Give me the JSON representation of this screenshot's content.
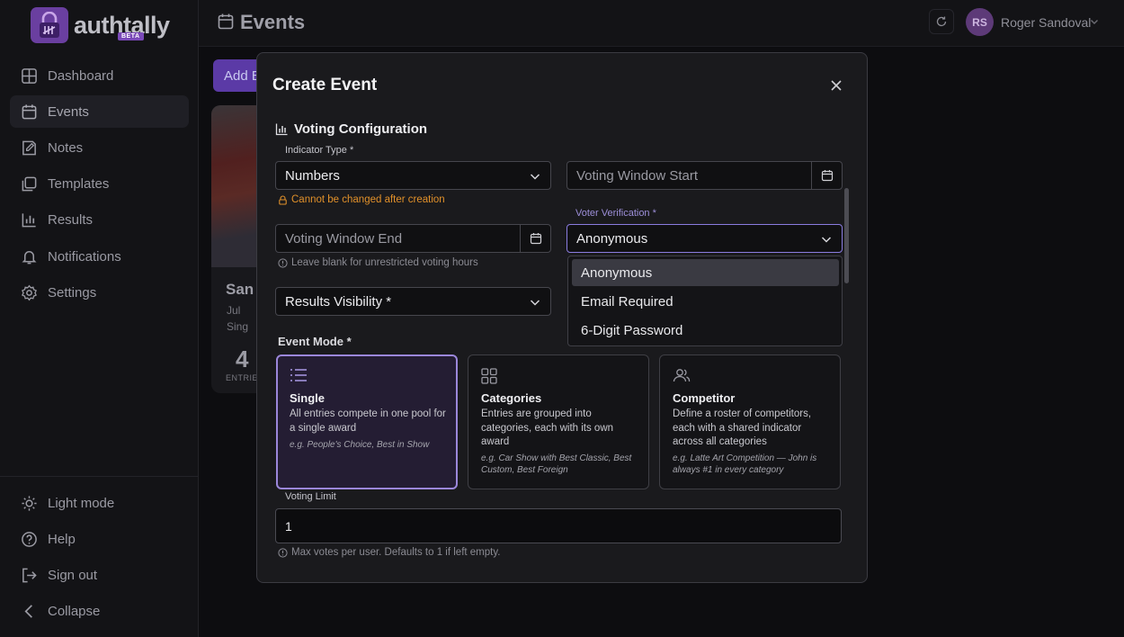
{
  "app": {
    "name": "authtally",
    "badge": "BETA"
  },
  "sidebar": {
    "items": [
      {
        "label": "Dashboard",
        "icon": "grid-icon"
      },
      {
        "label": "Events",
        "icon": "calendar-icon"
      },
      {
        "label": "Notes",
        "icon": "note-icon"
      },
      {
        "label": "Templates",
        "icon": "templates-icon"
      },
      {
        "label": "Results",
        "icon": "bar-chart-icon"
      },
      {
        "label": "Notifications",
        "icon": "bell-icon"
      },
      {
        "label": "Settings",
        "icon": "gear-icon"
      }
    ],
    "footer": [
      {
        "label": "Light mode",
        "icon": "sun-icon"
      },
      {
        "label": "Help",
        "icon": "help-icon"
      },
      {
        "label": "Sign out",
        "icon": "sign-out-icon"
      },
      {
        "label": "Collapse",
        "icon": "chevron-left-icon"
      }
    ]
  },
  "header": {
    "title": "Events",
    "user": {
      "initials": "RS",
      "name": "Roger Sandoval"
    }
  },
  "background": {
    "add_event_label": "Add Event",
    "card": {
      "title": "San A",
      "date": "Jul",
      "mode": "Sing",
      "count": "4",
      "count_label": "ENTRIES"
    }
  },
  "modal": {
    "title": "Create Event",
    "section": "Voting Configuration",
    "indicator_type": {
      "label": "Indicator Type *",
      "value": "Numbers",
      "warning": "Cannot be changed after creation"
    },
    "voting_window_start": {
      "placeholder": "Voting Window Start"
    },
    "voting_window_end": {
      "placeholder": "Voting Window End",
      "hint": "Leave blank for unrestricted voting hours"
    },
    "voter_verification": {
      "label": "Voter Verification *",
      "value": "Anonymous",
      "options": [
        "Anonymous",
        "Email Required",
        "6-Digit Password"
      ]
    },
    "results_visibility": {
      "placeholder": "Results Visibility *"
    },
    "event_mode": {
      "label": "Event Mode *",
      "options": [
        {
          "title": "Single",
          "desc": "All entries compete in one pool for a single award",
          "example": "e.g. People's Choice, Best in Show",
          "icon": "list-icon",
          "selected": true
        },
        {
          "title": "Categories",
          "desc": "Entries are grouped into categories, each with its own award",
          "example": "e.g. Car Show with Best Classic, Best Custom, Best Foreign",
          "icon": "grid-icon",
          "selected": false
        },
        {
          "title": "Competitor",
          "desc": "Define a roster of competitors, each with a shared indicator across all categories",
          "example": "e.g. Latte Art Competition — John is always #1 in every category",
          "icon": "users-icon",
          "selected": false
        }
      ]
    },
    "voting_limit": {
      "label": "Voting Limit",
      "value": "1",
      "hint": "Max votes per user. Defaults to 1 if left empty."
    }
  },
  "colors": {
    "accent": "#9b87da",
    "brand": "#6a3fa0",
    "warning": "#e0902a"
  }
}
